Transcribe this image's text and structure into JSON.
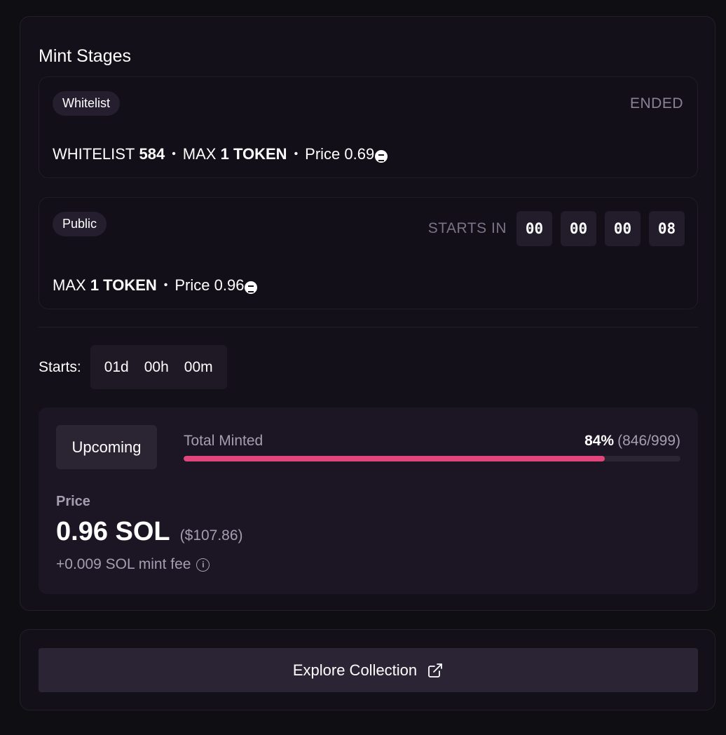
{
  "panel": {
    "title": "Mint Stages"
  },
  "stages": [
    {
      "badge": "Whitelist",
      "status": "ENDED",
      "whitelist_label": "WHITELIST",
      "whitelist_count": "584",
      "max_label": "MAX",
      "max_value": "1 TOKEN",
      "price_label": "Price",
      "price_value": "0.69",
      "currency_icon": "solana-icon"
    },
    {
      "badge": "Public",
      "starts_in_label": "STARTS IN",
      "countdown": [
        "00",
        "00",
        "00",
        "08"
      ],
      "max_label": "MAX",
      "max_value": "1 TOKEN",
      "price_label": "Price",
      "price_value": "0.96",
      "currency_icon": "solana-icon"
    }
  ],
  "starts": {
    "label": "Starts:",
    "days": "01d",
    "hours": "00h",
    "minutes": "00m"
  },
  "mint": {
    "status_button": "Upcoming",
    "total_minted_label": "Total Minted",
    "percent": "84%",
    "count": "(846/999)",
    "progress_fraction": 0.847,
    "progress_color": "#e0457b",
    "price_label": "Price",
    "price_value": "0.96 SOL",
    "price_usd": "($107.86)",
    "mint_fee": "+0.009 SOL mint fee",
    "fee_icon": "info-icon"
  },
  "explore": {
    "label": "Explore Collection",
    "icon": "external-link-icon"
  }
}
